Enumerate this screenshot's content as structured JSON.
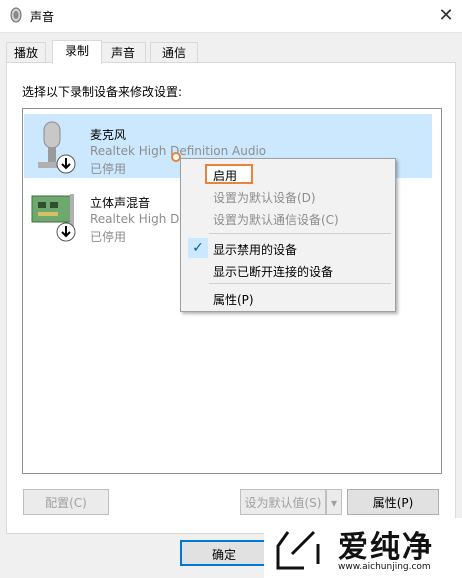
{
  "window": {
    "title": "声音",
    "close_icon": "close-icon"
  },
  "tabs": [
    {
      "label": "播放"
    },
    {
      "label": "录制"
    },
    {
      "label": "声音"
    },
    {
      "label": "通信"
    }
  ],
  "instruction": "选择以下录制设备来修改设置:",
  "devices": [
    {
      "name": "麦克风",
      "driver": "Realtek High Definition Audio",
      "status": "已停用",
      "icon": "microphone-icon"
    },
    {
      "name": "立体声混音",
      "driver": "Realtek High De",
      "status": "已停用",
      "icon": "sound-card-icon"
    }
  ],
  "context_menu": {
    "items": [
      {
        "label": "启用",
        "enabled": true
      },
      {
        "label": "设置为默认设备(D)",
        "enabled": false
      },
      {
        "label": "设置为默认通信设备(C)",
        "enabled": false
      },
      {
        "label": "显示禁用的设备",
        "checked": true
      },
      {
        "label": "显示已断开连接的设备"
      },
      {
        "label": "属性(P)"
      }
    ]
  },
  "buttons": {
    "configure": "配置(C)",
    "set_default": "设为默认值(S)",
    "properties": "属性(P)",
    "ok": "确定"
  },
  "watermark": {
    "text": "爱纯净",
    "url": "www.aichunjing.com"
  },
  "colors": {
    "selection": "#cce8ff",
    "highlight_border": "#e8833a",
    "accent": "#0078d7"
  }
}
